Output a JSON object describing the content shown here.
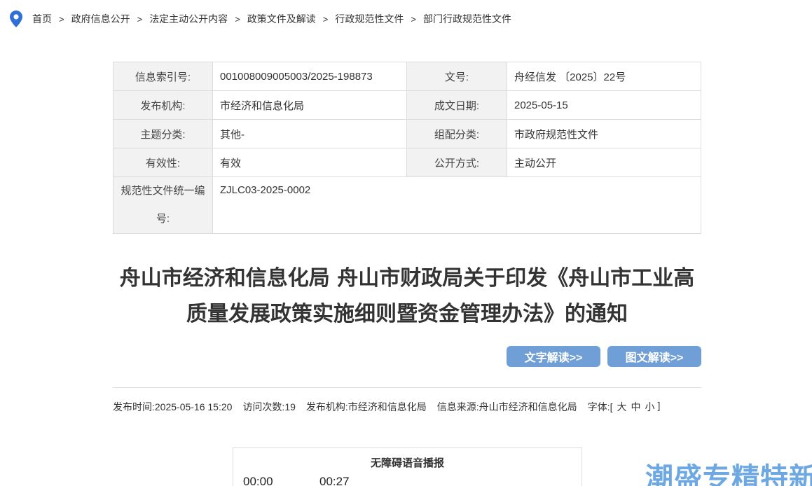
{
  "breadcrumb": {
    "items": [
      "首页",
      "政府信息公开",
      "法定主动公开内容",
      "政策文件及解读",
      "行政规范性文件",
      "部门行政规范性文件"
    ],
    "separator": ">"
  },
  "meta": {
    "index_label": "信息索引号:",
    "index_value": "001008009005003/2025-198873",
    "docno_label": "文号:",
    "docno_value": "舟经信发 〔2025〕22号",
    "publisher_label": "发布机构:",
    "publisher_value": "市经济和信息化局",
    "date_label": "成文日期:",
    "date_value": "2025-05-15",
    "topic_label": "主题分类:",
    "topic_value": "其他-",
    "category_label": "组配分类:",
    "category_value": "市政府规范性文件",
    "validity_label": "有效性:",
    "validity_value": "有效",
    "disclosure_label": "公开方式:",
    "disclosure_value": "主动公开",
    "code_label": "规范性文件统一编号:",
    "code_value": "ZJLC03-2025-0002"
  },
  "title": "舟山市经济和信息化局 舟山市财政局关于印发《舟山市工业高质量发展政策实施细则暨资金管理办法》的通知",
  "buttons": {
    "text_reading": "文字解读>>",
    "graphic_reading": "图文解读>>"
  },
  "info": {
    "publish_time": "发布时间:2025-05-16 15:20",
    "visits": "访问次数:19",
    "publisher": "发布机构:市经济和信息化局",
    "source": "信息来源:舟山市经济和信息化局",
    "font_label": "字体:[",
    "font_large": "大",
    "font_medium": "中",
    "font_small": "小",
    "font_close": "]"
  },
  "audio": {
    "title": "无障碍语音播报",
    "current_time": "00:00",
    "total_time": "00:27"
  },
  "watermark": "潮盛专精特新",
  "colors": {
    "accent": "#6f9fd6",
    "pin": "#2f6fd6",
    "watermark": "#5f9fe0"
  }
}
